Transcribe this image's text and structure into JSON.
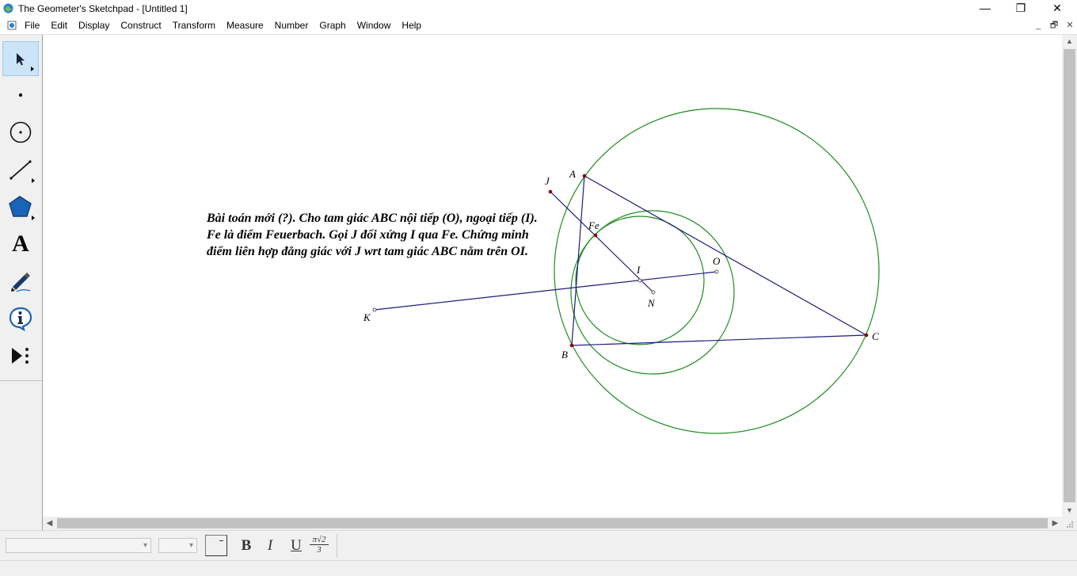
{
  "window": {
    "title": "The Geometer's Sketchpad - [Untitled 1]",
    "minimize": "—",
    "maximize": "❐",
    "close": "✕"
  },
  "menu": {
    "items": [
      "File",
      "Edit",
      "Display",
      "Construct",
      "Transform",
      "Measure",
      "Number",
      "Graph",
      "Window",
      "Help"
    ]
  },
  "mdi": {
    "minimize": "_",
    "restore": "🗗",
    "close": "✕"
  },
  "toolbox": {
    "tools": [
      "arrow-tool",
      "point-tool",
      "compass-tool",
      "straightedge-tool",
      "polygon-tool",
      "text-tool",
      "marker-tool",
      "information-tool",
      "custom-tool"
    ],
    "selected": "arrow-tool",
    "text_tool_glyph": "A"
  },
  "sketch": {
    "problem_text": "Bài toán mới (?). Cho tam giác ABC nội tiếp (O), ngoại tiếp (I). Fe là điểm Feuerbach. Gọi J đối xứng I qua Fe. Chứng minh điểm liên hợp đẳng giác với J wrt tam giác ABC nằm trên OI.",
    "points": {
      "A": "A",
      "B": "B",
      "C": "C",
      "O": "O",
      "I": "I",
      "N": "N",
      "J": "J",
      "K": "K",
      "Fe": "Fe"
    },
    "colors": {
      "circle": "#1e8c1e",
      "segment": "#1c1c7a",
      "point": "#8b0000"
    }
  },
  "textbar": {
    "font_family_value": "",
    "font_size_value": "",
    "bold": "B",
    "italic": "I",
    "underline": "U",
    "math_format_top": "π√2",
    "math_format_bottom": "3"
  }
}
